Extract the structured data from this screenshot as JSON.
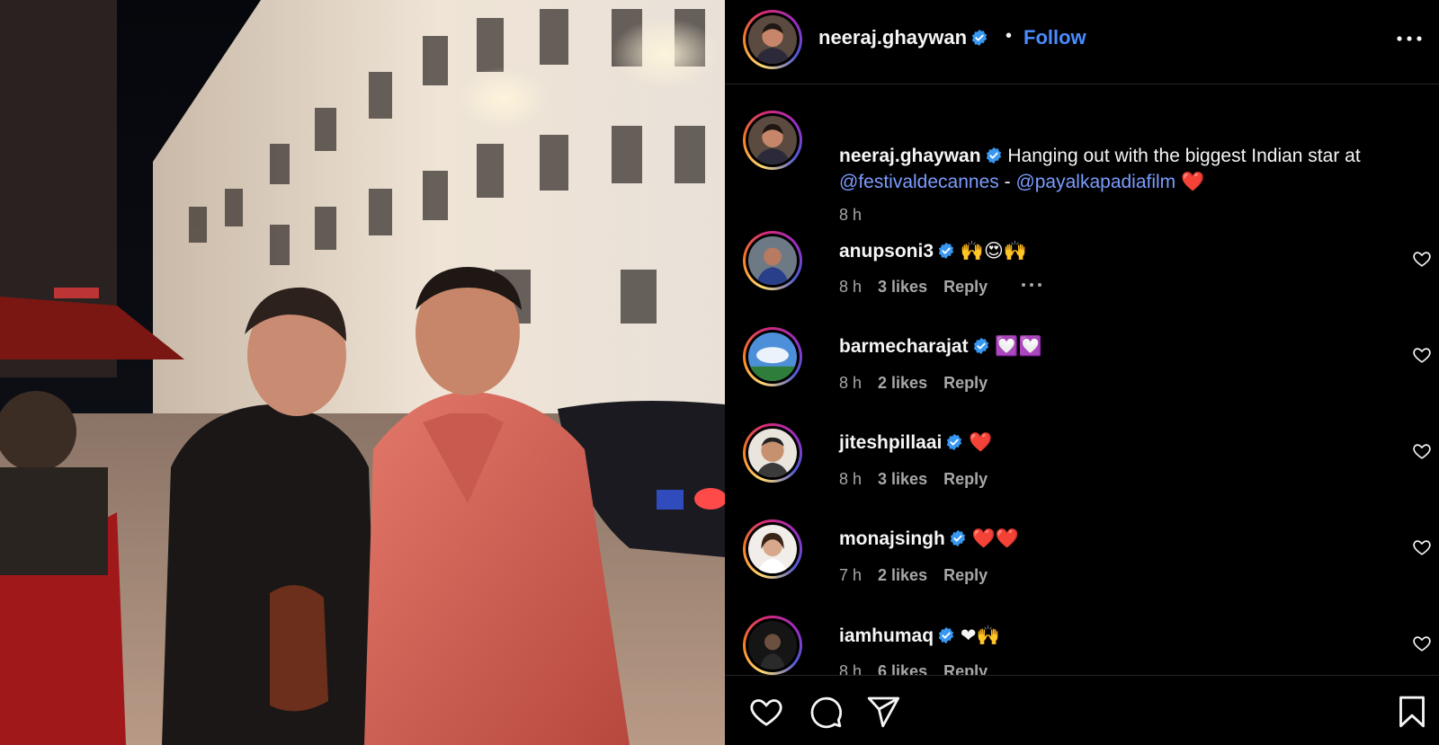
{
  "post": {
    "username": "neeraj.ghaywan",
    "separator": "•",
    "follow_label": "Follow",
    "caption": {
      "username": "neeraj.ghaywan",
      "text_1": "Hanging out with the biggest Indian star at",
      "mention_1": "@festivaldecannes",
      "dash": " - ",
      "mention_2": "@payalkapadiafilm",
      "emoji": "❤️",
      "time": "8 h"
    }
  },
  "comments": [
    {
      "username": "anupsoni3",
      "text": "🙌😍🙌",
      "time": "8 h",
      "likes": "3 likes",
      "reply": "Reply"
    },
    {
      "username": "barmecharajat",
      "text": "💟💟",
      "time": "8 h",
      "likes": "2 likes",
      "reply": "Reply"
    },
    {
      "username": "jiteshpillaai",
      "text": "❤️",
      "time": "8 h",
      "likes": "3 likes",
      "reply": "Reply"
    },
    {
      "username": "monajsingh",
      "text": "❤️❤️",
      "time": "7 h",
      "likes": "2 likes",
      "reply": "Reply"
    },
    {
      "username": "iamhumaq",
      "text": "❤🙌",
      "time": "8 h",
      "likes": "6 likes",
      "reply": "Reply"
    }
  ],
  "icons": {
    "verified": "verified-badge-icon",
    "more": "more-horizontal-icon",
    "like": "heart-icon",
    "comment": "comment-icon",
    "share": "send-icon",
    "save": "bookmark-icon"
  },
  "colors": {
    "accent": "#4a8cff",
    "mention": "#7b9cff",
    "verified": "#3897f0",
    "muted": "#a8a8a8"
  }
}
